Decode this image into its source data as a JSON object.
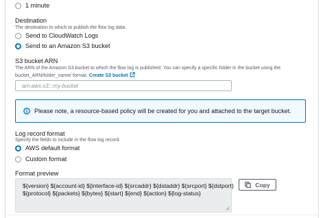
{
  "aggregation": {
    "option_1_minute": "1 minute"
  },
  "destination": {
    "heading": "Destination",
    "description": "The destination to which to publish the flow log data.",
    "options": [
      "Send to CloudWatch Logs",
      "Send to an Amazon S3 bucket"
    ],
    "selected": "Send to an Amazon S3 bucket"
  },
  "s3_bucket_arn": {
    "heading": "S3 bucket ARN",
    "description_line1": "The ARN of the Amazon S3 bucket to which the flow log is published. You can specify a specific folder in the bucket using the",
    "description_line2": "bucket_ARN/folder_name/ format.",
    "create_link": "Create S3 bucket",
    "placeholder": "arn:aws:s3:::my-bucket",
    "value": ""
  },
  "alert": {
    "icon": "info-icon",
    "text": "Please note, a resource-based policy will be created for you and attached to the target bucket."
  },
  "log_record_format": {
    "heading": "Log record format",
    "description": "Specify the fields to include in the flow log record.",
    "options": [
      "AWS default format",
      "Custom format"
    ],
    "selected": "AWS default format"
  },
  "format_preview": {
    "heading": "Format preview",
    "line1": "${version} ${account-id} ${interface-id} ${srcaddr} ${dstaddr} ${srcport} ${dstport}",
    "line2": "${protocol} ${packets} ${bytes} ${start} ${end} ${action} ${log-status}",
    "copy_label": "Copy"
  },
  "colors": {
    "accent": "#0073bb",
    "alert_background": "#f1faff",
    "preview_background": "#eaeded"
  }
}
